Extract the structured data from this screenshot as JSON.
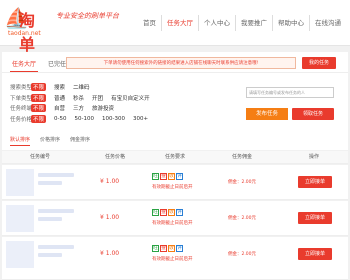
{
  "logo": {
    "mark": "⛵",
    "text": "淘单",
    "sub": "taodan.net",
    "slogan": "专业安全的刷单平台"
  },
  "nav": [
    "首页",
    "任务大厅",
    "个人中心",
    "我要推广",
    "帮助中心",
    "在线沟通"
  ],
  "tabs": [
    "任务大厅",
    "已完任务"
  ],
  "notice": "下单请勿使用任何搜索外的链接的结果进入店铺在线聊天时联系供应请注意哦!",
  "publish_top": "我的任务",
  "filters": [
    {
      "label": "搜索类型",
      "options": [
        "不限",
        "搜索",
        "二维码"
      ]
    },
    {
      "label": "下单类型",
      "options": [
        "不限",
        "普通",
        "秒杀",
        "开团",
        "有宝贝自定义开"
      ]
    },
    {
      "label": "任务终端",
      "options": [
        "不限",
        "自营",
        "三方",
        "旅游投资"
      ]
    },
    {
      "label": "任务价格",
      "options": [
        "不限",
        "0-50",
        "50-100",
        "100-300",
        "300+"
      ]
    }
  ],
  "search_placeholder": "请填写任务编号或发布任务的人",
  "btn_publish": "发布任务",
  "btn_pickup": "领取任务",
  "sort": [
    "默认排序",
    "价格排序",
    "佣金排序"
  ],
  "table": {
    "headers": [
      "任务编号",
      "任务价格",
      "任务要求",
      "任务佣金",
      "操作"
    ]
  },
  "rows": [
    {
      "price": "¥ 1.00",
      "reqs": [
        "旺",
        "搜",
        "收",
        "评"
      ],
      "note": "有效期截止日前后开",
      "commission": "佣金：2.00元",
      "action": "立即接单"
    },
    {
      "price": "¥ 1.00",
      "reqs": [
        "旺",
        "搜",
        "收",
        "评"
      ],
      "note": "有效期截止日前后开",
      "commission": "佣金：2.00元",
      "action": "立即接单"
    },
    {
      "price": "¥ 1.00",
      "reqs": [
        "旺",
        "搜",
        "收",
        "评"
      ],
      "note": "有效期截止日前后开",
      "commission": "佣金：2.00元",
      "action": "立即接单"
    }
  ],
  "colors": {
    "brand_red": "#e93b2d",
    "orange": "#f57e14"
  }
}
